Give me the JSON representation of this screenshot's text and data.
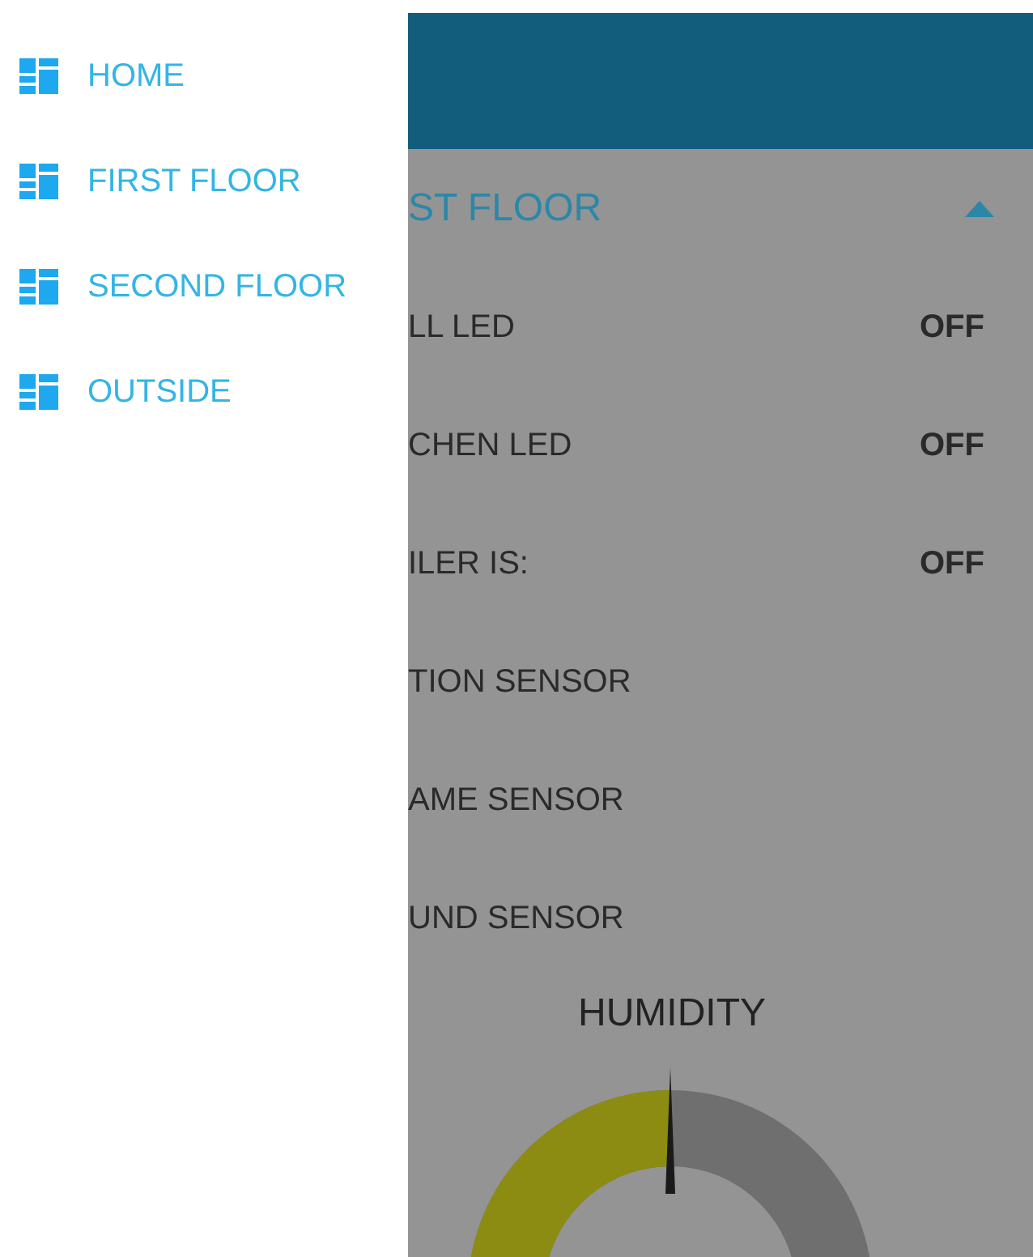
{
  "drawer": {
    "items": [
      {
        "label": "HOME"
      },
      {
        "label": "FIRST FLOOR"
      },
      {
        "label": "SECOND FLOOR"
      },
      {
        "label": "OUTSIDE"
      }
    ]
  },
  "section": {
    "title": "ST FLOOR",
    "expanded": true
  },
  "rows": [
    {
      "label": "LL LED",
      "value": "OFF"
    },
    {
      "label": "CHEN LED",
      "value": "OFF"
    },
    {
      "label": "ILER IS:",
      "value": "OFF"
    },
    {
      "label": "TION SENSOR"
    },
    {
      "label": "AME SENSOR"
    },
    {
      "label": "UND SENSOR"
    }
  ],
  "gauge": {
    "title": "HUMIDITY",
    "level": 0.5
  }
}
